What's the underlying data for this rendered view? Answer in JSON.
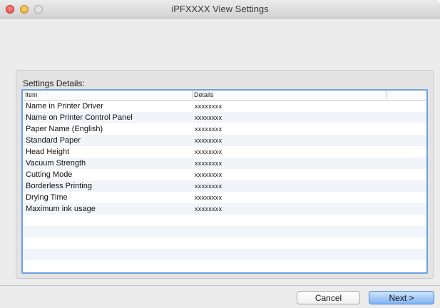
{
  "window": {
    "title": "iPFXXXX View Settings"
  },
  "settings_details": {
    "label": "Settings Details:",
    "columns": {
      "item": "Item",
      "details": "Details"
    },
    "rows": [
      {
        "item": "Name in Printer Driver",
        "details": "xxxxxxxx"
      },
      {
        "item": "Name on Printer Control Panel",
        "details": "xxxxxxxx"
      },
      {
        "item": "Paper Name (English)",
        "details": "xxxxxxxx"
      },
      {
        "item": "Standard Paper",
        "details": "xxxxxxxx"
      },
      {
        "item": "Head Height",
        "details": "xxxxxxxx"
      },
      {
        "item": "Vacuum Strength",
        "details": "xxxxxxxx"
      },
      {
        "item": "Cutting Mode",
        "details": "xxxxxxxx"
      },
      {
        "item": "Borderless Printing",
        "details": "xxxxxxxx"
      },
      {
        "item": "Drying Time",
        "details": "xxxxxxxx"
      },
      {
        "item": "Maximum ink usage",
        "details": "xxxxxxxx"
      },
      {
        "item": "",
        "details": ""
      },
      {
        "item": "",
        "details": ""
      },
      {
        "item": "",
        "details": ""
      },
      {
        "item": "",
        "details": ""
      },
      {
        "item": "",
        "details": ""
      }
    ]
  },
  "buttons": {
    "cancel": "Cancel",
    "next": "Next >"
  }
}
